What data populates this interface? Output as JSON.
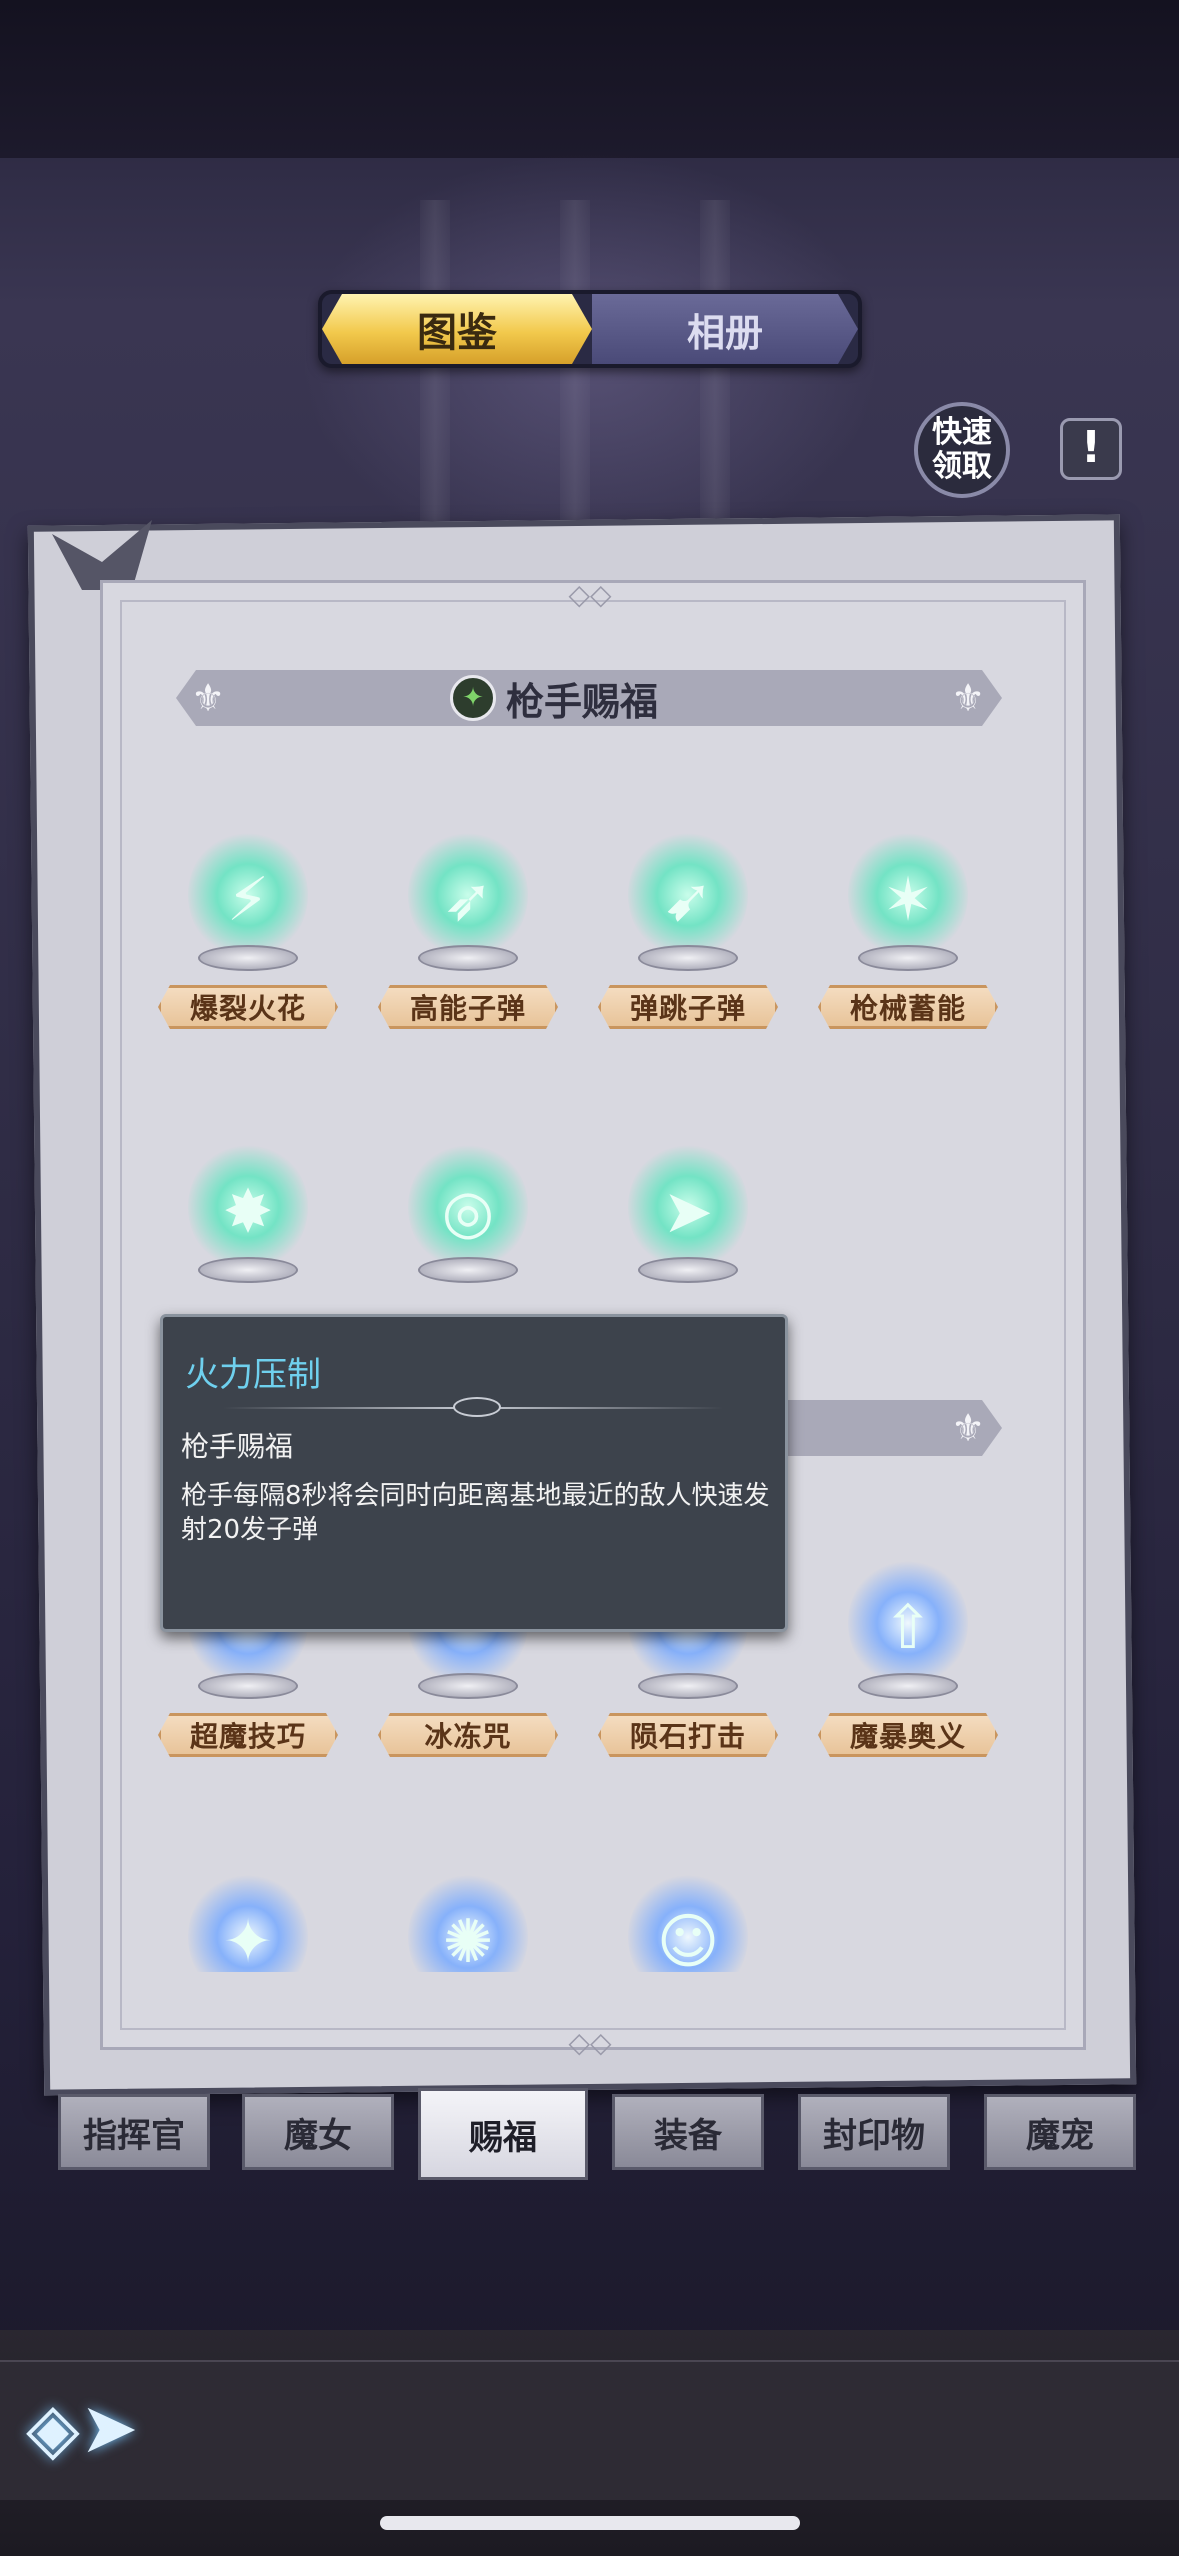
{
  "header": {
    "tabs": [
      {
        "label": "图鉴",
        "active": true
      },
      {
        "label": "相册",
        "active": false
      }
    ],
    "quick_claim_label": "快速\n领取",
    "info_label": "!"
  },
  "section": {
    "title": "枪手赐福",
    "icon": "rifle-icon"
  },
  "blessings_row1": [
    {
      "label": "爆裂火花",
      "icon": "bullet-spark-icon"
    },
    {
      "label": "高能子弹",
      "icon": "energy-bullet-icon"
    },
    {
      "label": "弹跳子弹",
      "icon": "bounce-bullet-icon"
    },
    {
      "label": "枪械蓄能",
      "icon": "rifle-charge-icon"
    }
  ],
  "blessings_row2": [
    {
      "icon": "missile-burst-icon"
    },
    {
      "icon": "targeted-shell-icon"
    },
    {
      "icon": "arrow-barrage-icon"
    }
  ],
  "magic_row": [
    {
      "label": "超魔技巧",
      "icon": "arcane-orb-icon"
    },
    {
      "label": "冰冻咒",
      "icon": "ice-curse-icon"
    },
    {
      "label": "陨石打击",
      "icon": "meteor-icon"
    },
    {
      "label": "魔暴奥义",
      "icon": "magic-storm-icon"
    }
  ],
  "magic_row2": [
    {
      "icon": "light-orb-icon"
    },
    {
      "icon": "starburst-icon"
    },
    {
      "icon": "figure-icon"
    }
  ],
  "tooltip": {
    "title": "火力压制",
    "subtitle": "枪手赐福",
    "description": "枪手每隔8秒将会同时向距离基地最近的敌人快速发射20发子弹"
  },
  "bottom_tabs": [
    {
      "label": "指挥官",
      "active": false
    },
    {
      "label": "魔女",
      "active": false
    },
    {
      "label": "赐福",
      "active": true
    },
    {
      "label": "装备",
      "active": false
    },
    {
      "label": "封印物",
      "active": false
    },
    {
      "label": "魔宠",
      "active": false
    }
  ],
  "colors": {
    "tab_active": "#f2c94c",
    "tooltip_title": "#6fd0ee",
    "label_bg": "#e8c49a",
    "glow_green": "#5ae6be",
    "glow_blue": "#78aaff"
  }
}
